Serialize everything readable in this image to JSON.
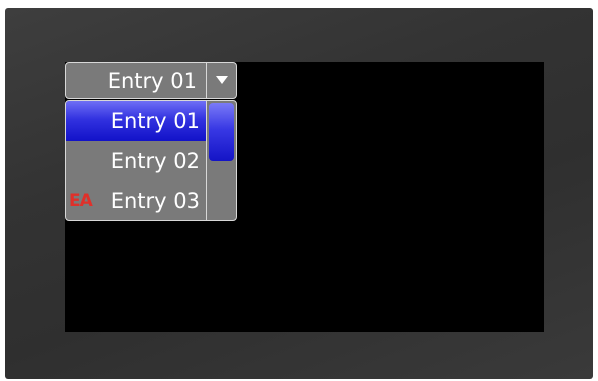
{
  "combo": {
    "selected_value": "Entry 01"
  },
  "dropdown": {
    "items": [
      {
        "label": "Entry 01",
        "selected": true
      },
      {
        "label": "Entry 02",
        "selected": false
      },
      {
        "label": "Entry 03",
        "selected": false,
        "logo_text": "EA"
      }
    ],
    "scroll_position": 0
  },
  "colors": {
    "bezel": "#333333",
    "screen": "#000000",
    "widget_background": "#7a7a7a",
    "widget_border": "#d8d8d8",
    "selection": "#3232e0",
    "logo": "#e0302a"
  },
  "icons": {
    "combo_arrow": "triangle-down-icon",
    "logo": "ea-logo"
  }
}
